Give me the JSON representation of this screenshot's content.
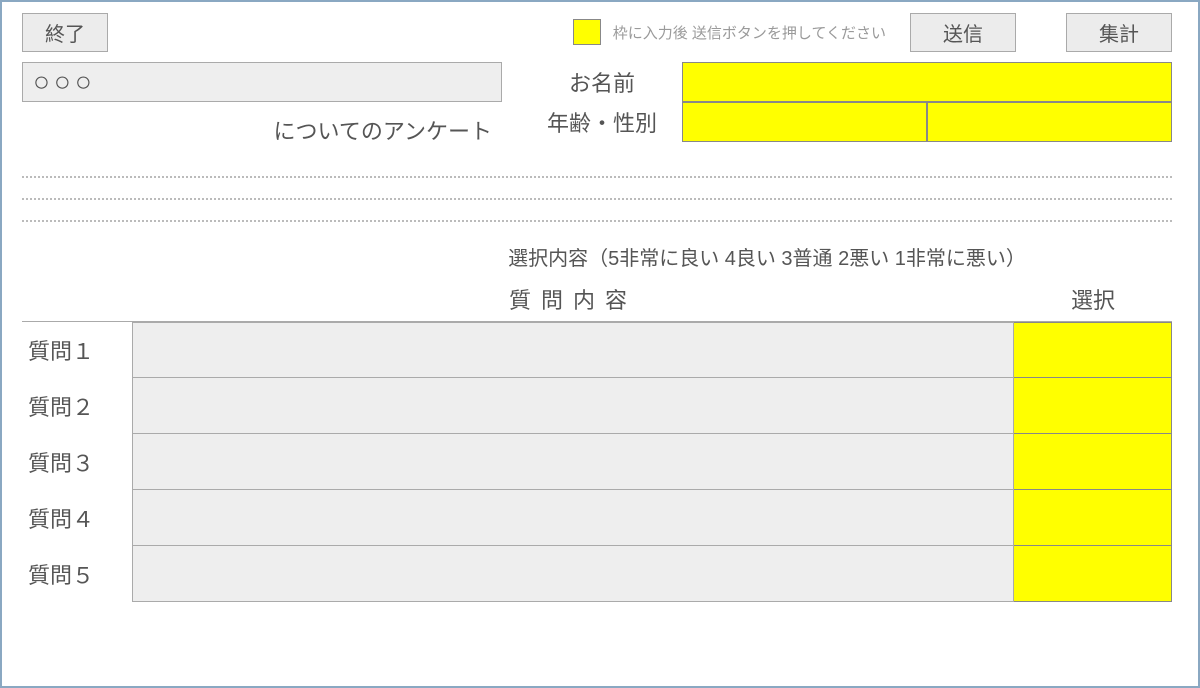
{
  "toolbar": {
    "exit_label": "終了",
    "legend_text": "枠に入力後 送信ボタンを押してください",
    "send_label": "送信",
    "tally_label": "集計"
  },
  "header": {
    "title_value": "○○○",
    "subtitle": "についてのアンケート",
    "name_label": "お名前",
    "agegender_label": "年齢・性別",
    "name_value": "",
    "age_value": "",
    "gender_value": ""
  },
  "scale_legend": "選択内容（5非常に良い 4良い 3普通 2悪い 1非常に悪い）",
  "table": {
    "col_content": "質問内容",
    "col_select": "選択"
  },
  "questions": [
    {
      "label": "質問１",
      "content": "",
      "select": ""
    },
    {
      "label": "質問２",
      "content": "",
      "select": ""
    },
    {
      "label": "質問３",
      "content": "",
      "select": ""
    },
    {
      "label": "質問４",
      "content": "",
      "select": ""
    },
    {
      "label": "質問５",
      "content": "",
      "select": ""
    }
  ]
}
